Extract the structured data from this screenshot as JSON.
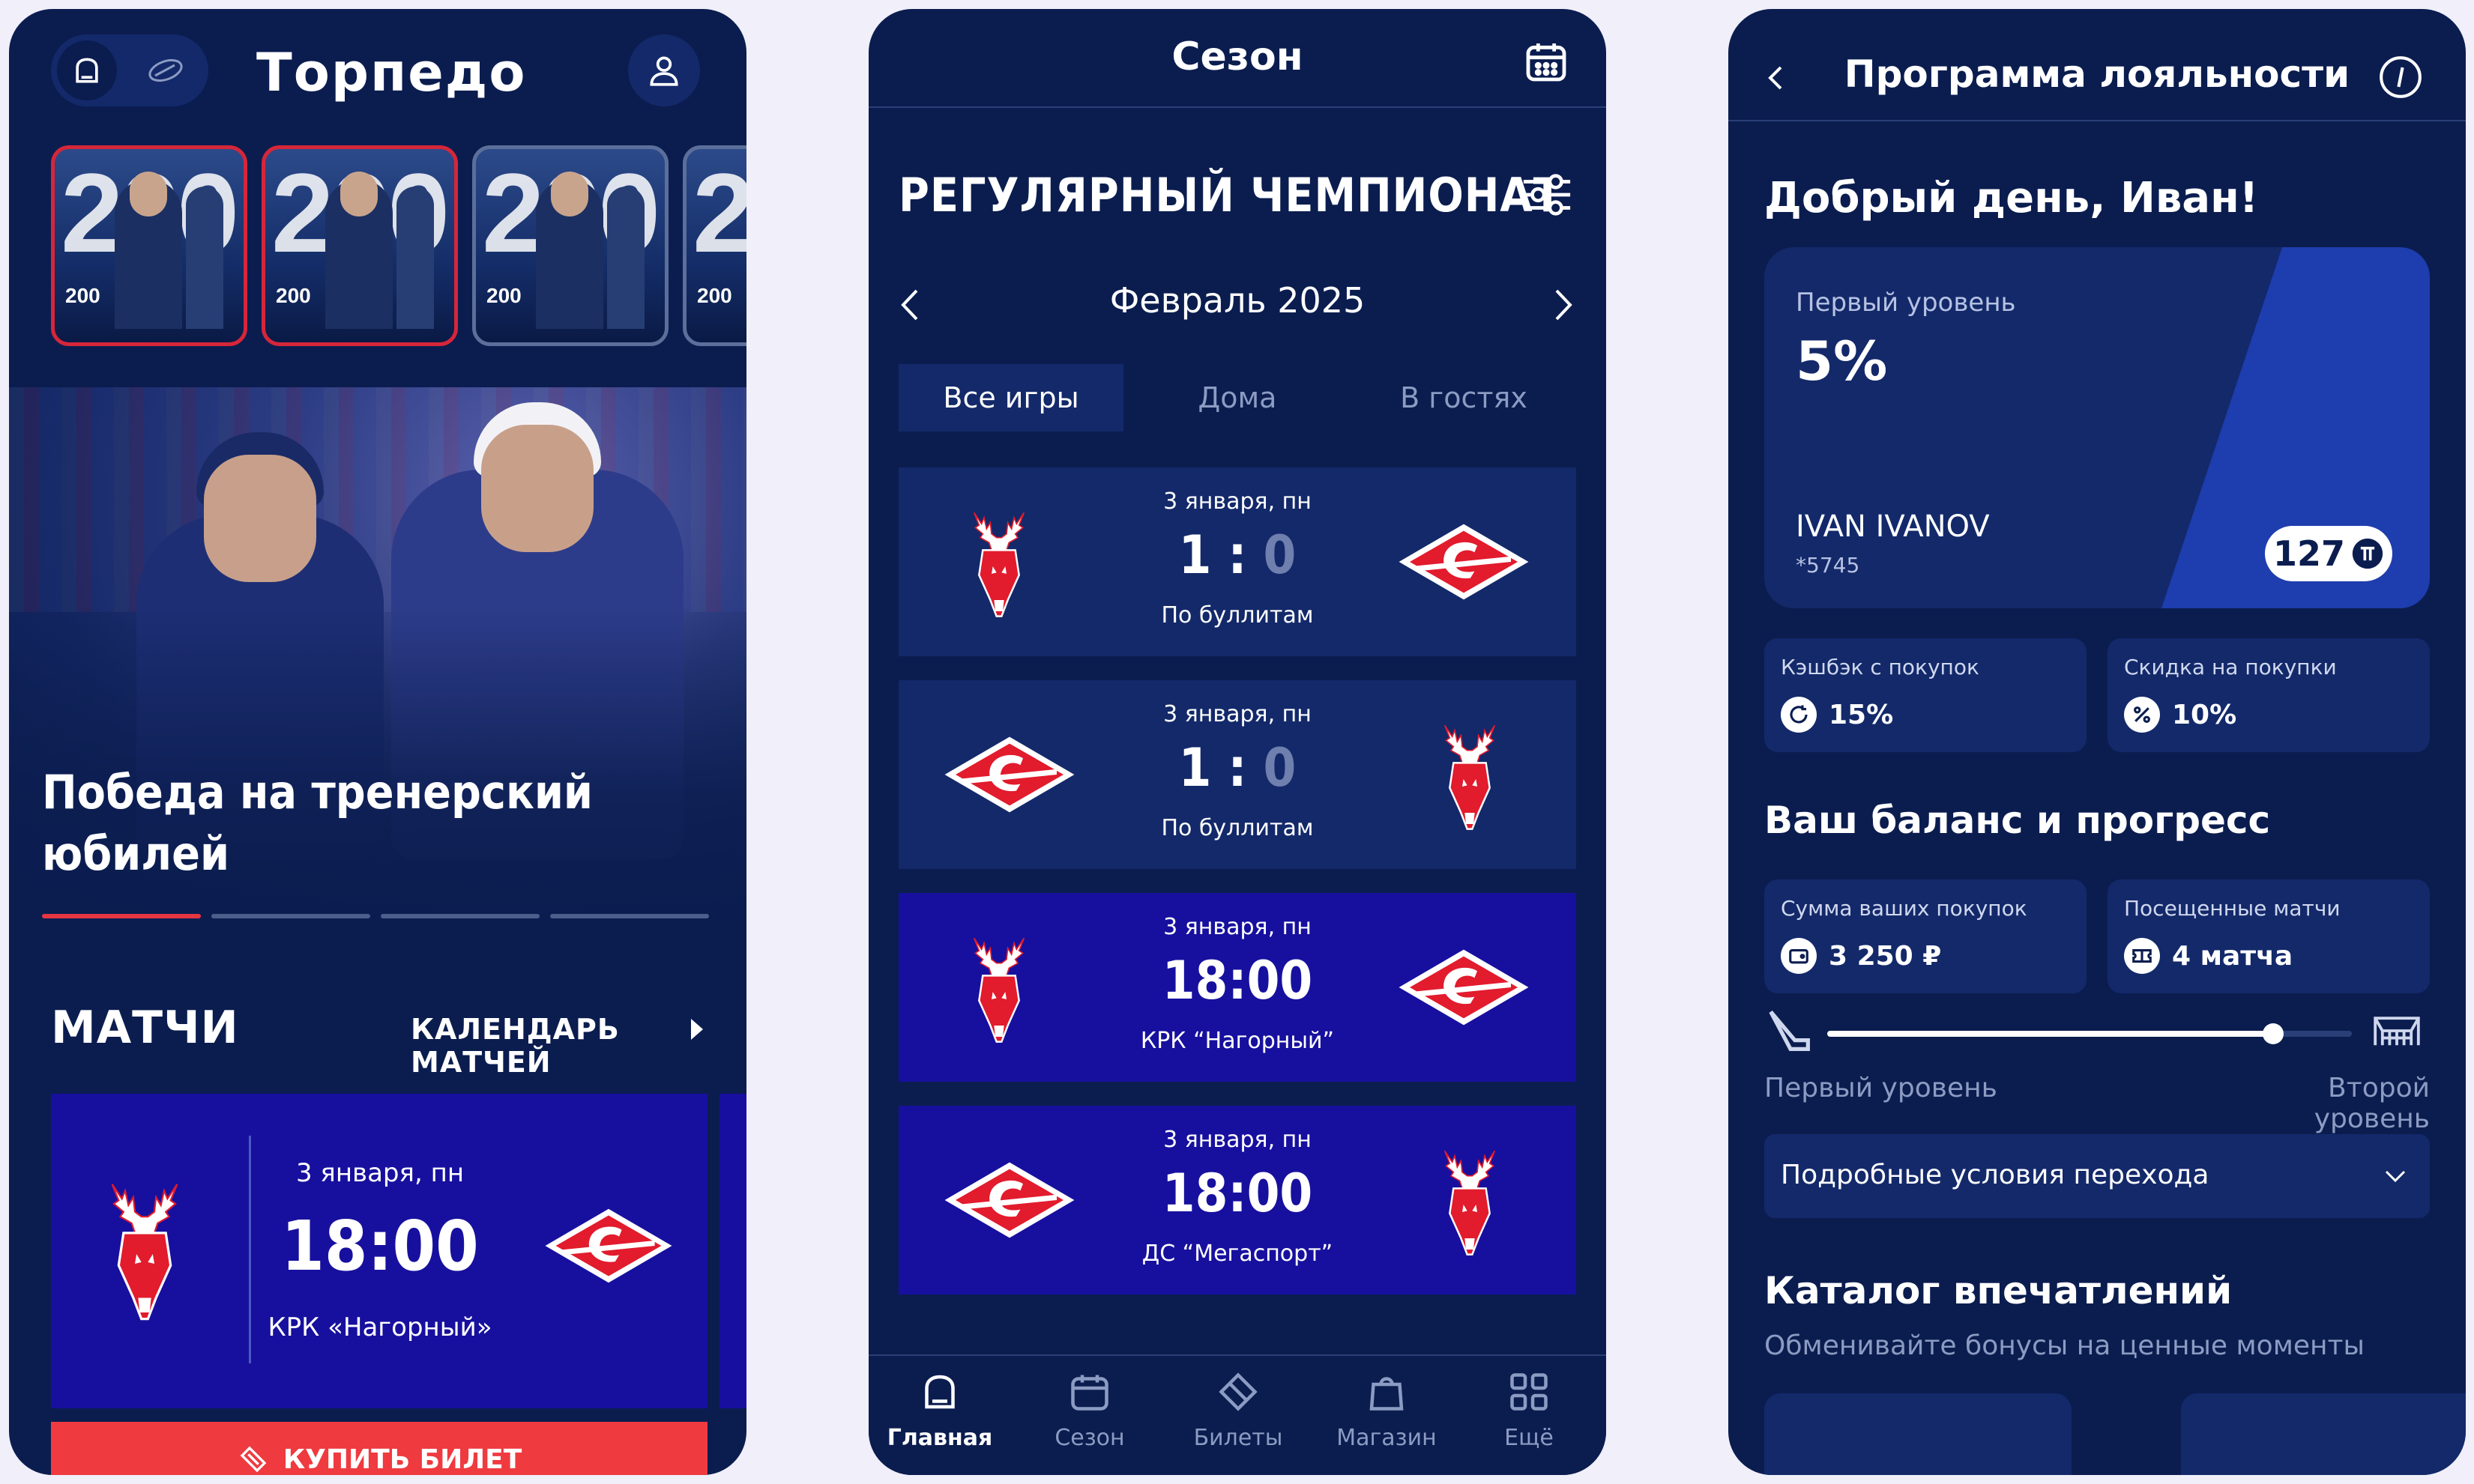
{
  "phone1": {
    "logo": "Торпедо",
    "stories": [
      {
        "big": "200",
        "caption": "200"
      },
      {
        "big": "200",
        "caption": "200"
      },
      {
        "big": "200",
        "caption": "200"
      },
      {
        "big": "200",
        "caption": "200"
      }
    ],
    "hero_title": "Победа на тренерский юбилей",
    "slider": {
      "count": 4,
      "active": 0
    },
    "section_title": "МАТЧИ",
    "section_link": "КАЛЕНДАРЬ МАТЧЕЙ",
    "match": {
      "date": "3 января, пн",
      "time": "18:00",
      "venue": "КРК «Нагорный»"
    },
    "buy_button": "КУПИТЬ БИЛЕТ"
  },
  "phone2": {
    "header_title": "Сезон",
    "championship": "РЕГУЛЯРНЫЙ ЧЕМПИОНАТ",
    "month": "Февраль 2025",
    "tabs": [
      "Все игры",
      "Дома",
      "В гостях"
    ],
    "active_tab": 0,
    "games": [
      {
        "date": "3 января, пн",
        "left": "1",
        "sep": " : ",
        "right": "0",
        "sub": "По буллитам",
        "home": "torpedo",
        "away": "spartak",
        "upcoming": false
      },
      {
        "date": "3 января, пн",
        "left": "1",
        "sep": " : ",
        "right": "0",
        "sub": "По буллитам",
        "home": "spartak",
        "away": "torpedo",
        "upcoming": false
      },
      {
        "date": "3 января, пн",
        "time": "18:00",
        "sub": "КРК “Нагорный”",
        "home": "torpedo",
        "away": "spartak",
        "upcoming": true
      },
      {
        "date": "3 января, пн",
        "time": "18:00",
        "sub": "ДС “Мегаспорт”",
        "home": "spartak",
        "away": "torpedo",
        "upcoming": true
      }
    ],
    "tabbar": [
      {
        "label": "Главная",
        "icon": "home-icon",
        "active": true
      },
      {
        "label": "Сезон",
        "icon": "calendar-icon",
        "active": false
      },
      {
        "label": "Билеты",
        "icon": "ticket-icon",
        "active": false
      },
      {
        "label": "Магазин",
        "icon": "bag-icon",
        "active": false
      },
      {
        "label": "Ещё",
        "icon": "grid-icon",
        "active": false
      }
    ]
  },
  "phone3": {
    "header_title": "Программа лояльности",
    "greeting": "Добрый день, Иван!",
    "card": {
      "level": "Первый уровень",
      "percent": "5%",
      "name": "IVAN IVANOV",
      "number": "*5745",
      "balance": "127"
    },
    "tiles_top": [
      {
        "label": "Кэшбэк с покупок",
        "value": "15%",
        "icon": "refresh-icon"
      },
      {
        "label": "Скидка на покупки",
        "value": "10%",
        "icon": "percent-icon"
      }
    ],
    "balance_title": "Ваш баланс и прогресс",
    "tiles_bottom": [
      {
        "label": "Сумма ваших покупок",
        "value": "3 250 ₽",
        "icon": "wallet-icon"
      },
      {
        "label": "Посещенные матчи",
        "value": "4 матча",
        "icon": "ticket-icon"
      }
    ],
    "progress": 0.85,
    "level_left": "Первый уровень",
    "level_right": "Второй уровень",
    "conditions": "Подробные условия перехода",
    "catalog_title": "Каталог впечатлений",
    "catalog_sub": "Обменивайте бонусы на ценные моменты"
  },
  "colors": {
    "navy": "#0b1d4f",
    "panel": "#13296a",
    "accent_red": "#ef3a40",
    "upcoming_blue": "#17109e"
  }
}
